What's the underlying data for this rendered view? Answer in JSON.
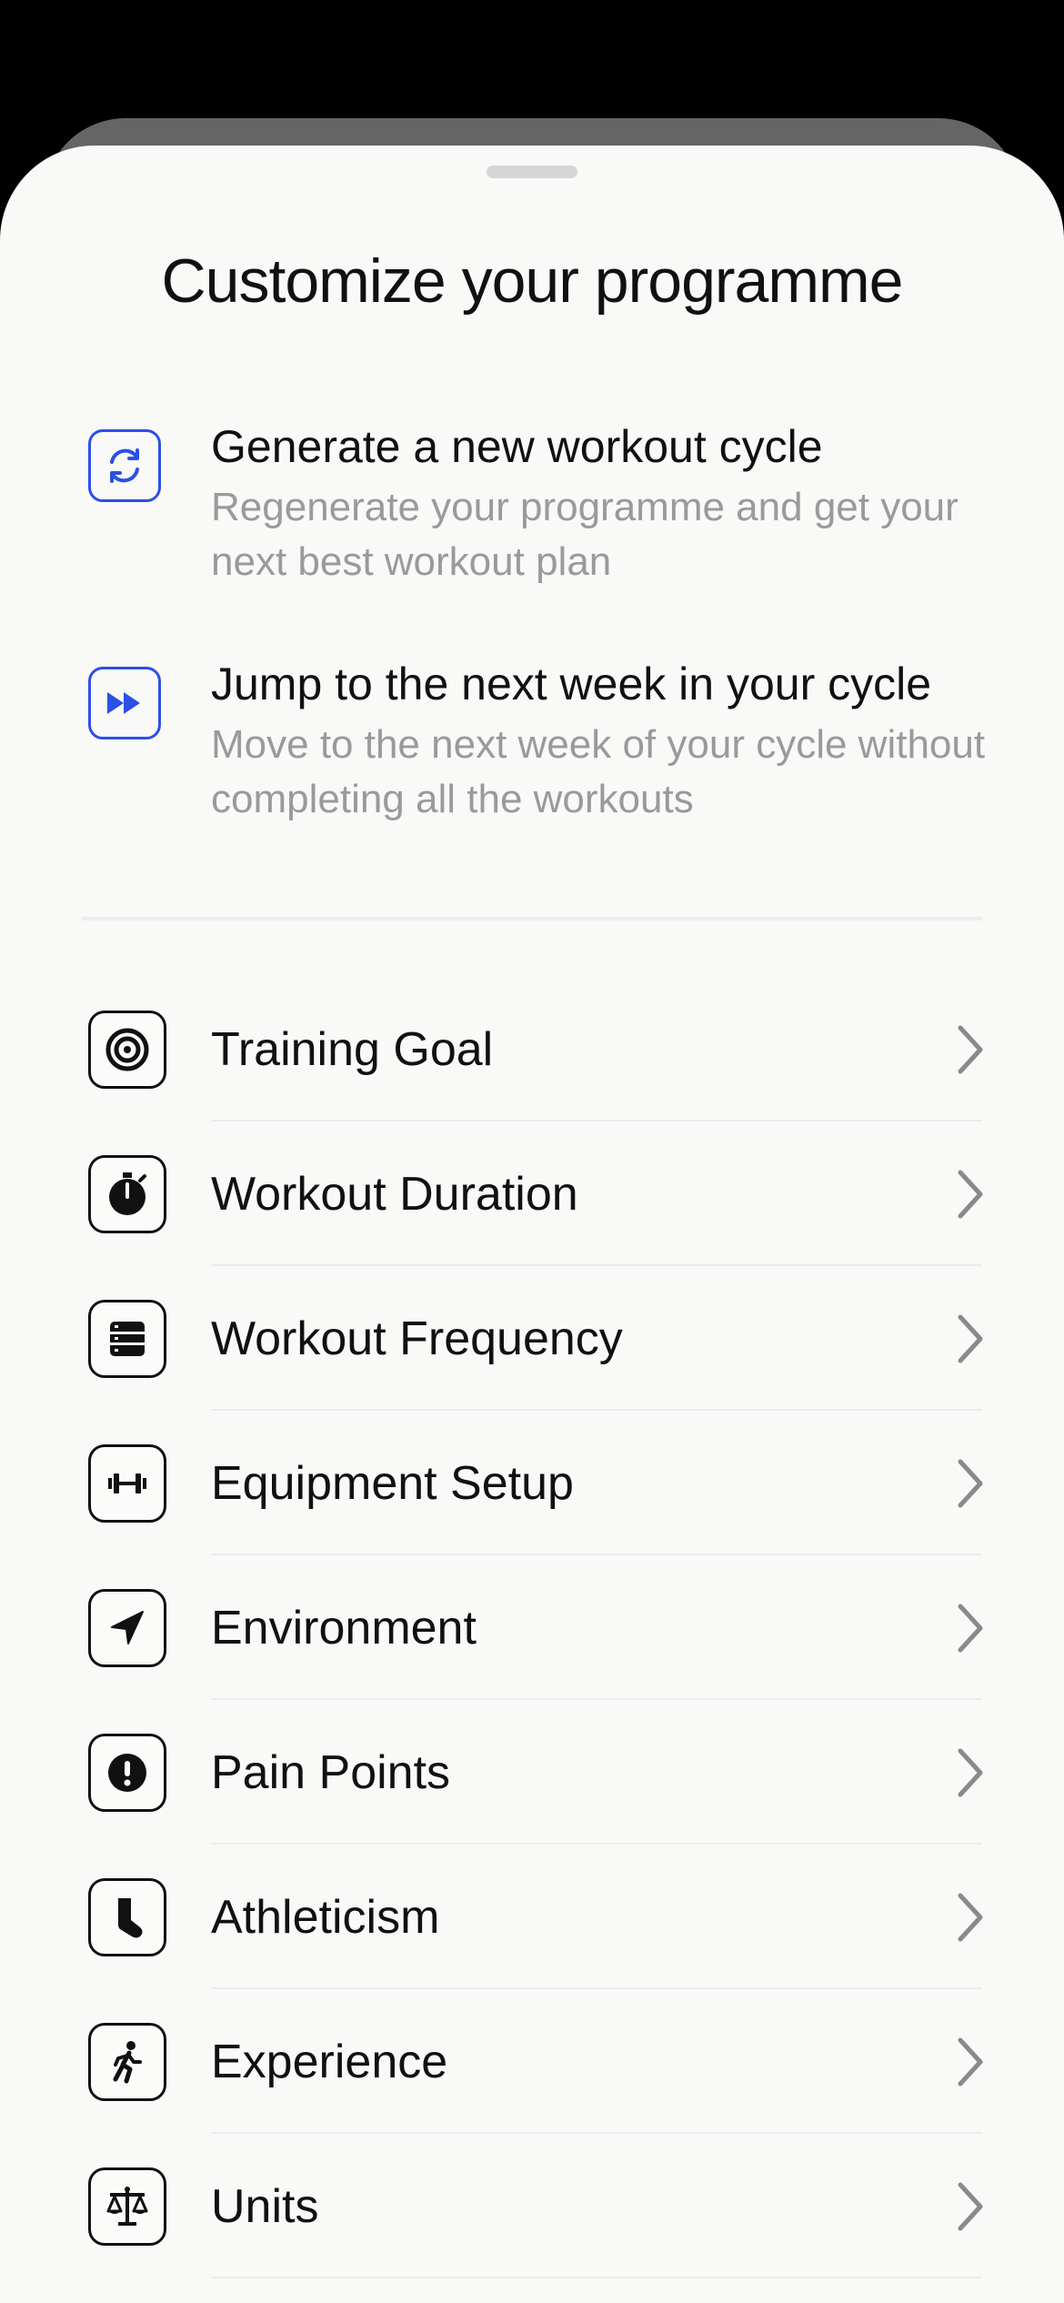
{
  "sheet": {
    "title": "Customize your programme"
  },
  "actions": [
    {
      "icon": "refresh-icon",
      "title": "Generate a new workout cycle",
      "description": "Regenerate your programme and get your next best workout plan"
    },
    {
      "icon": "fast-forward-icon",
      "title": "Jump to the next week in your cycle",
      "description": "Move to the next week of your cycle without completing all the workouts"
    }
  ],
  "settings": [
    {
      "icon": "target-icon",
      "label": "Training Goal"
    },
    {
      "icon": "stopwatch-icon",
      "label": "Workout Duration"
    },
    {
      "icon": "list-icon",
      "label": "Workout Frequency"
    },
    {
      "icon": "dumbbell-icon",
      "label": "Equipment Setup"
    },
    {
      "icon": "location-arrow-icon",
      "label": "Environment"
    },
    {
      "icon": "alert-icon",
      "label": "Pain Points"
    },
    {
      "icon": "sock-icon",
      "label": "Athleticism"
    },
    {
      "icon": "running-person-icon",
      "label": "Experience"
    },
    {
      "icon": "scale-icon",
      "label": "Units"
    }
  ],
  "colors": {
    "accent": "#2c4fe8",
    "sheet_background": "#f9f9f8",
    "secondary_text": "#9a9a9a"
  }
}
